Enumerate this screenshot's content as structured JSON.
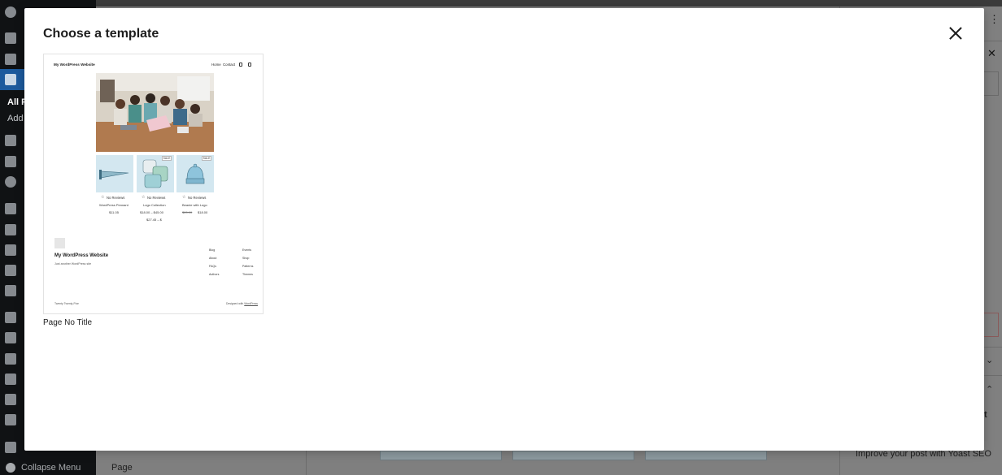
{
  "sidebar": {
    "submenu_all": "All P",
    "submenu_add": "Add",
    "collapse_label": "Collapse Menu"
  },
  "editor_bg": {
    "page_tab": "Page",
    "yoast_text": "Improve your post with Yoast SEO",
    "panel_fragment": "t"
  },
  "modal": {
    "title": "Choose a template",
    "close_label": "Close",
    "templates": [
      {
        "label": "Page No Title",
        "preview": {
          "site_title": "My WordPress Website",
          "nav": [
            "Home",
            "Contact"
          ],
          "products": [
            {
              "reviews": "No Reviews",
              "name": "WordPress Pennant",
              "price": "$11.05",
              "sale": ""
            },
            {
              "reviews": "No Reviews",
              "name": "Logo Collection",
              "price": "$18.00 – $45.00",
              "price_extra": "$27.45 – $",
              "sale": "SALE"
            },
            {
              "reviews": "No Reviews",
              "name": "Beanie with Logo",
              "price_old": "$20.00",
              "price": "$18.00",
              "sale": "SALE"
            }
          ],
          "footer_title": "My WordPress Website",
          "footer_tagline": "Just another WordPress site",
          "footer_col1": [
            "Blog",
            "About",
            "FAQs",
            "Authors"
          ],
          "footer_col2": [
            "Events",
            "Shop",
            "Patterns",
            "Themes"
          ],
          "footer_left": "Twenty Twenty-Five",
          "footer_right_prefix": "Designed with ",
          "footer_right_link": "WordPress"
        }
      }
    ]
  }
}
